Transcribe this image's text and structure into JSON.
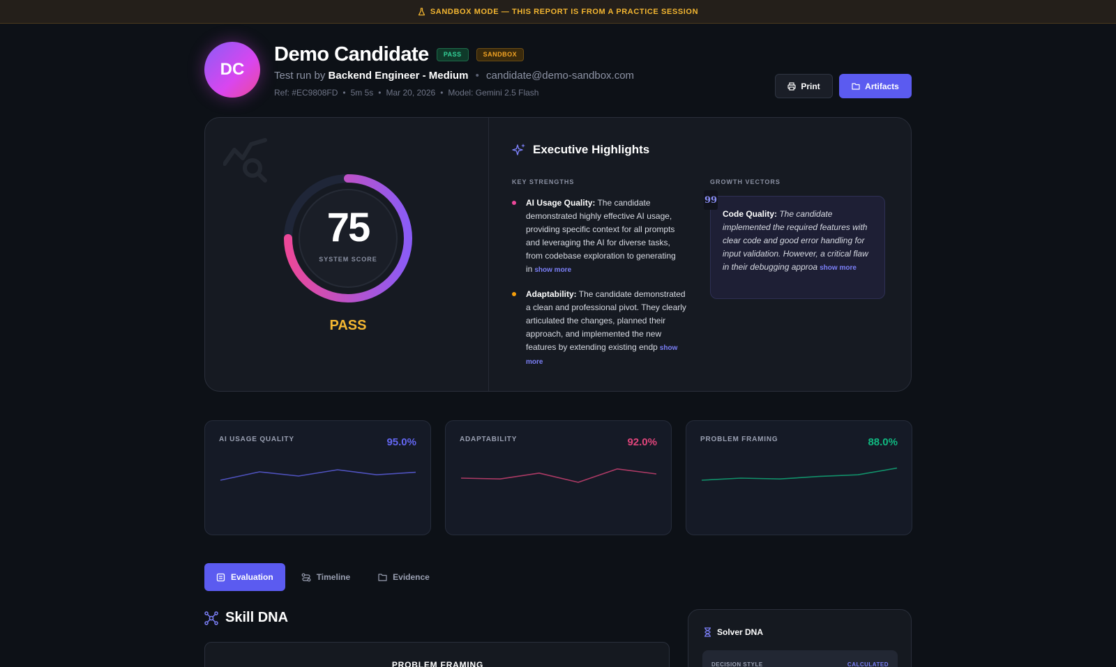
{
  "banner": {
    "text": "SANDBOX MODE — THIS REPORT IS FROM A PRACTICE SESSION",
    "color": "#f5b731"
  },
  "header": {
    "initials": "DC",
    "name": "Demo Candidate",
    "badges": {
      "pass": "PASS",
      "sandbox": "SANDBOX"
    },
    "test_run_prefix": "Test run by",
    "role": "Backend Engineer - Medium",
    "dot": "•",
    "email": "candidate@demo-sandbox.com",
    "meta": {
      "ref": "Ref: #EC9808FD",
      "duration": "5m 5s",
      "date": "Mar 20, 2026",
      "model": "Model: Gemini 2.5 Flash",
      "sep": "•"
    },
    "buttons": {
      "print": "Print",
      "artifacts": "Artifacts"
    }
  },
  "score_panel": {
    "score": "75",
    "score_value": 0.75,
    "score_label": "SYSTEM SCORE",
    "verdict": "PASS"
  },
  "highlights": {
    "title": "Executive Highlights",
    "key_strengths_label": "KEY STRENGTHS",
    "growth_vectors_label": "GROWTH VECTORS",
    "strengths": [
      {
        "title": "AI Usage Quality:",
        "text": " The candidate demonstrated highly effective AI usage, providing specific context for all prompts and leveraging the AI for diverse tasks, from codebase exploration to generating in",
        "more": "show more",
        "bullet_color": "#ec4899"
      },
      {
        "title": "Adaptability:",
        "text": " The candidate demonstrated a clean and professional pivot. They clearly articulated the changes, planned their approach, and implemented the new features by extending existing endp",
        "more": "show more",
        "bullet_color": "#f59e0b"
      }
    ],
    "growth": {
      "quote_mark": "99",
      "title": "Code Quality:",
      "text": " The candidate implemented the required features with clear code and good error handling for input validation. However, a critical flaw in their debugging approa",
      "more": "show more"
    }
  },
  "metrics": [
    {
      "label": "AI USAGE QUALITY",
      "value": "95.0%",
      "color": "#6366f1",
      "trend": [
        45,
        65,
        55,
        70,
        58,
        64
      ]
    },
    {
      "label": "ADAPTABILITY",
      "value": "92.0%",
      "color": "#e0457b",
      "trend": [
        50,
        48,
        62,
        40,
        72,
        60
      ]
    },
    {
      "label": "PROBLEM FRAMING",
      "value": "88.0%",
      "color": "#10b981",
      "trend": [
        45,
        50,
        48,
        54,
        58,
        74
      ]
    }
  ],
  "tabs": [
    {
      "label": "Evaluation",
      "active": true
    },
    {
      "label": "Timeline",
      "active": false
    },
    {
      "label": "Evidence",
      "active": false
    }
  ],
  "skill_dna": {
    "title": "Skill DNA",
    "card_label": "PROBLEM FRAMING"
  },
  "solver_dna": {
    "title": "Solver DNA",
    "row_label": "DECISION STYLE",
    "row_value": "CALCULATED"
  }
}
